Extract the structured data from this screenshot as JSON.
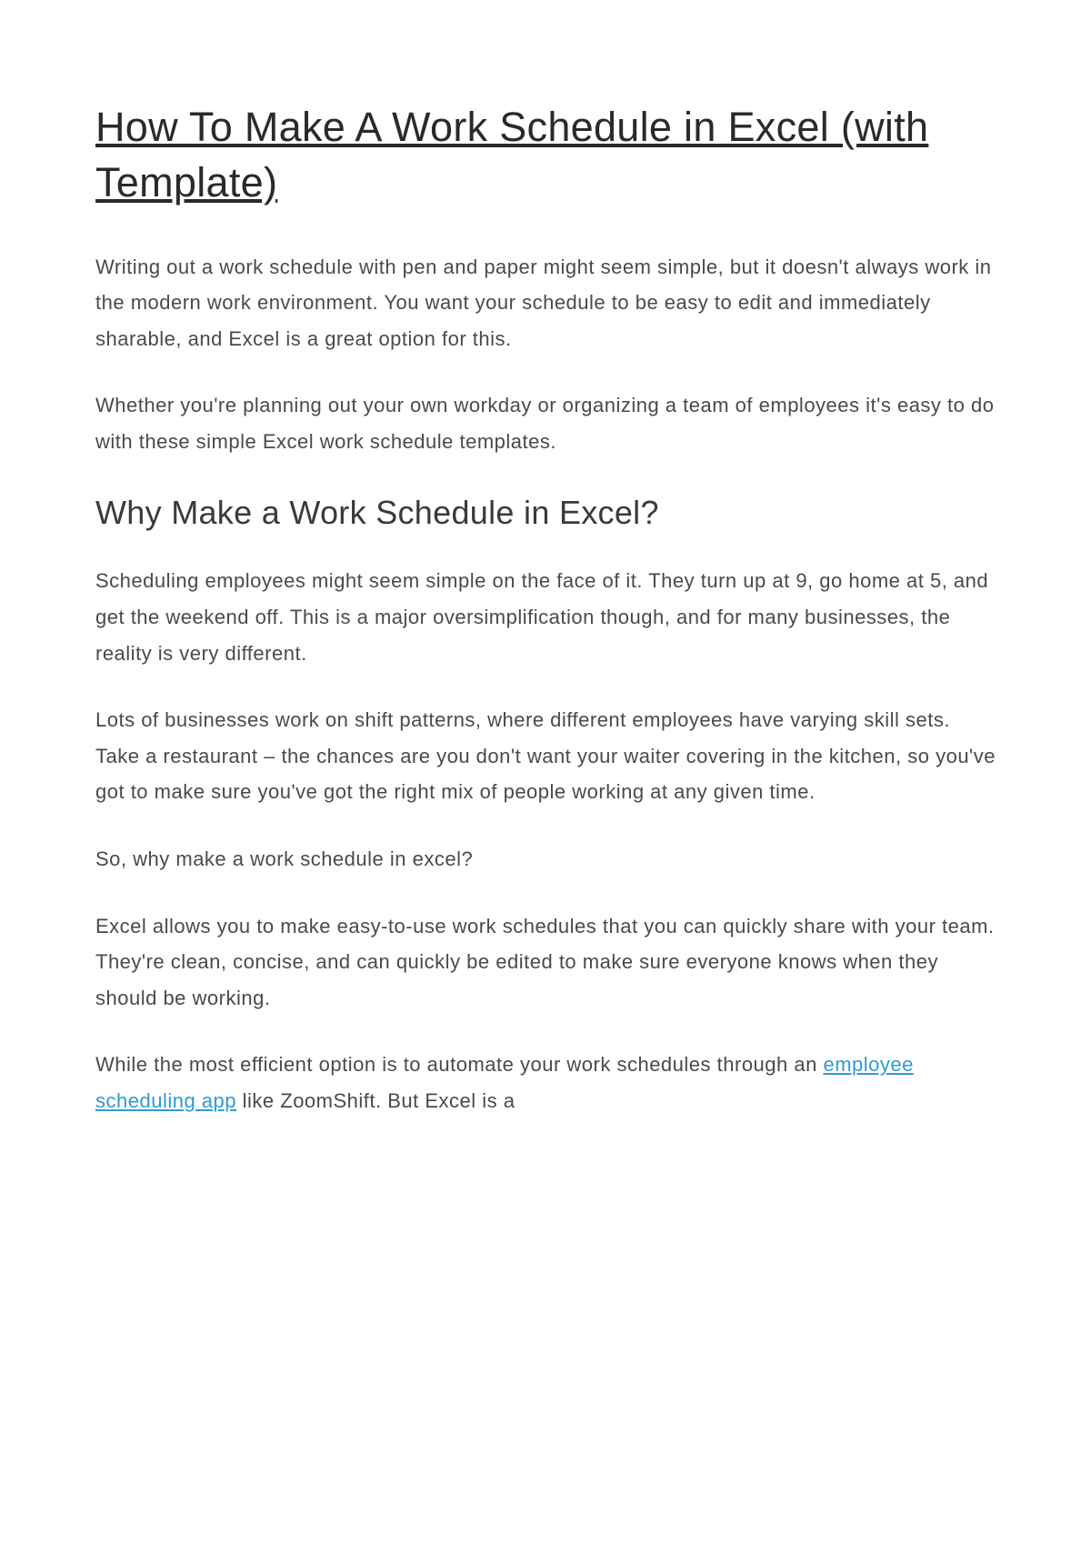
{
  "title": "How To Make A Work Schedule in Excel (with Template)",
  "intro": {
    "p1": "Writing out a work schedule with pen and paper might seem simple, but it doesn't always work in the modern work environment. You want your schedule to be easy to edit and immediately sharable, and Excel is a great option for this.",
    "p2": "Whether you're planning out your own workday or organizing a team of employees it's easy to do with these simple Excel work schedule templates."
  },
  "section1": {
    "heading": "Why Make a Work Schedule in Excel?",
    "p1": "Scheduling employees might seem simple on the face of it. They turn up at 9, go home at 5, and get the weekend off. This is a major oversimplification though, and for many businesses, the reality is very different.",
    "p2": "Lots of businesses work on shift patterns, where different employees have varying skill sets. Take a restaurant – the chances are you don't want your waiter covering in the kitchen, so you've got to make sure you've got the right mix of people working at any given time.",
    "p3": "So, why make a work schedule in excel?",
    "p4": "Excel allows you to make easy-to-use work schedules that you can quickly share with your team. They're clean, concise, and can quickly be edited to make sure everyone knows when they should be working.",
    "p5_before": "While the most efficient option is to automate your work schedules through an ",
    "p5_link": "employee scheduling app",
    "p5_after": " like ZoomShift. But Excel is a"
  }
}
